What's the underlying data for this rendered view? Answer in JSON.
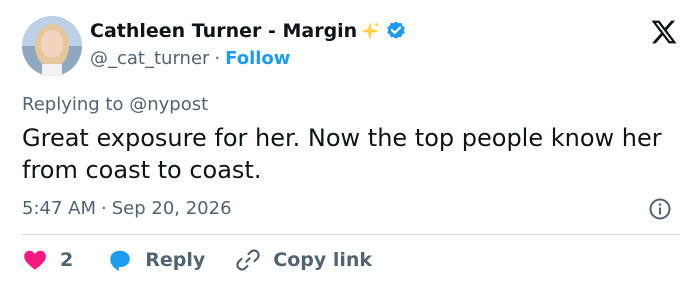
{
  "author": {
    "display_name": "Cathleen Turner - Margin",
    "handle": "@_cat_turner",
    "separator": "·",
    "follow_label": "Follow"
  },
  "reply_context": {
    "prefix": "Replying to",
    "mention": "@nypost"
  },
  "tweet": {
    "text": "Great exposure for her. Now the top people know her from coast to coast.",
    "time": "5:47 AM",
    "separator": "·",
    "date": "Sep 20, 2026"
  },
  "actions": {
    "like_count": "2",
    "reply_label": "Reply",
    "copy_link_label": "Copy link"
  },
  "colors": {
    "accent": "#1d9bf0",
    "like": "#f91880",
    "text": "#0f1419",
    "secondary": "#536471",
    "sparkle": "#ffd23f"
  },
  "icons": {
    "brand": "x-logo-icon",
    "verified": "verified-badge-icon",
    "sparkle": "sparkle-icon",
    "info": "info-icon",
    "like": "heart-icon",
    "reply": "speech-bubble-icon",
    "copy_link": "link-icon"
  }
}
